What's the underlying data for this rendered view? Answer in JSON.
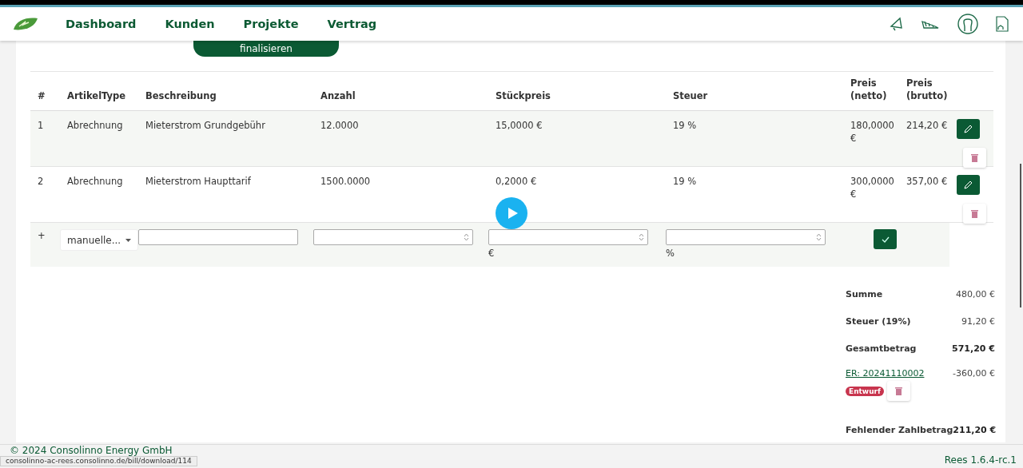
{
  "nav": {
    "items": [
      {
        "label": "Dashboard"
      },
      {
        "label": "Kunden"
      },
      {
        "label": "Projekte"
      },
      {
        "label": "Vertrag"
      }
    ]
  },
  "finalize_button": "finalisieren",
  "table": {
    "columns": [
      "#",
      "ArtikelType",
      "Beschreibung",
      "Anzahl",
      "Stückpreis",
      "Steuer",
      "Preis (netto)",
      "Preis (brutto)"
    ],
    "rows": [
      {
        "index": "1",
        "type": "Abrechnung",
        "description": "Mieterstrom Grundgebühr",
        "quantity": "12.0000",
        "unit_price": "15,0000 €",
        "tax": "19 %",
        "net": "180,0000 €",
        "gross": "214,20 €"
      },
      {
        "index": "2",
        "type": "Abrechnung",
        "description": "Mieterstrom Haupttarif",
        "quantity": "1500.0000",
        "unit_price": "0,2000 €",
        "tax": "19 %",
        "net": "300,0000 €",
        "gross": "357,00 €"
      }
    ],
    "new_row": {
      "marker": "+",
      "type_select": "manuelle...",
      "price_unit": "€",
      "tax_unit": "%"
    }
  },
  "summary": [
    {
      "label": "Summe",
      "value": "480,00 €",
      "bold_value": false
    },
    {
      "label": "Steuer (19%)",
      "value": "91,20 €",
      "bold_value": false
    },
    {
      "label": "Gesamtbetrag",
      "value": "571,20 €",
      "bold_value": true
    }
  ],
  "payment": {
    "link": "ER: 20241110002",
    "amount": "-360,00 €",
    "badge": "Entwurf"
  },
  "missing": {
    "label": "Fehlender Zahlbetrag",
    "value": "211,20 €"
  },
  "footer": {
    "copyright": "© 2024 Consolinno Energy GmbH",
    "version": "Rees 1.6.4-rc.1",
    "status_url": "consolinno-ac-rees.consolinno.de/bill/download/114"
  }
}
